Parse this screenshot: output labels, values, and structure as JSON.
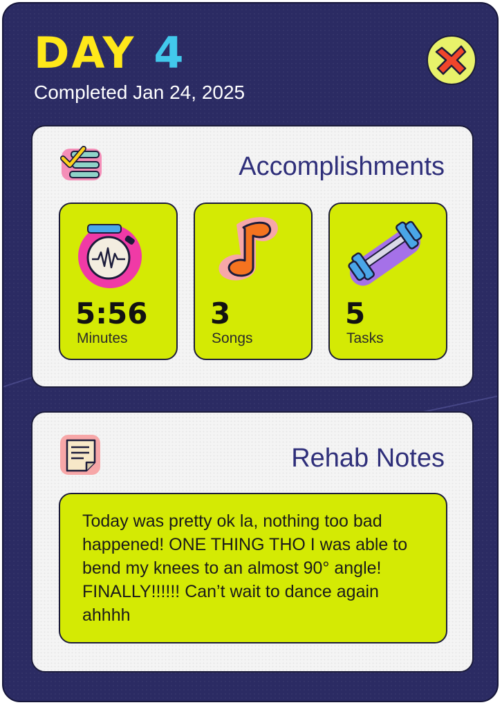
{
  "header": {
    "title_word": "DAY",
    "title_number": "4",
    "subtitle": "Completed Jan 24, 2025"
  },
  "close_button": {
    "icon": "close-x-icon"
  },
  "accomplishments": {
    "title": "Accomplishments",
    "icon": "checklist-icon",
    "stats": [
      {
        "value": "5:56",
        "label": "Minutes",
        "icon": "stopwatch-icon"
      },
      {
        "value": "3",
        "label": "Songs",
        "icon": "music-note-icon"
      },
      {
        "value": "5",
        "label": "Tasks",
        "icon": "dumbbell-icon"
      }
    ]
  },
  "notes": {
    "title": "Rehab Notes",
    "icon": "notepad-icon",
    "body": "Today was pretty ok la, nothing too bad happened! ONE THING THO I was able to bend my knees to an almost 90° angle! FINALLY!!!!!! Can’t wait to dance again ahhhh"
  },
  "colors": {
    "background": "#2b2b63",
    "title_day": "#ffe81a",
    "title_number": "#42c9ec",
    "accent_lime": "#d4ea04",
    "card": "#f4f4f4",
    "card_title": "#2f2f7a",
    "close_bg": "#e8f26a",
    "close_x": "#f0452b"
  }
}
